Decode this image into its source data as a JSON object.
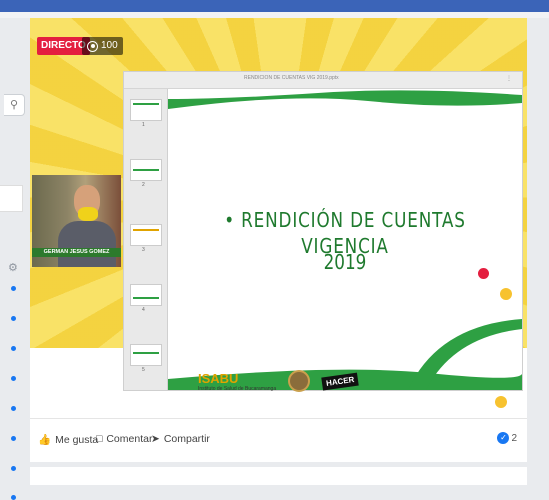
{
  "live": {
    "badge": "DIRECTO",
    "viewers": "100"
  },
  "webcam": {
    "name_label": "GERMAN JESUS GOMEZ"
  },
  "slide_window": {
    "title": "RENDICION DE CUENTAS VIG 2019.pptx",
    "thumbnail_numbers": [
      "1",
      "2",
      "3",
      "4",
      "5"
    ]
  },
  "slide": {
    "title": "• RENDICIÓN DE CUENTAS VIGENCIA",
    "year": "2019"
  },
  "logos": {
    "isabu": "ISABU",
    "isabu_sub": "Instituto de Salud de Bucaramanga",
    "hacer": "HACER"
  },
  "actions": {
    "like": "Me gusta",
    "comment": "Comentar",
    "share": "Compartir",
    "like_count": "2"
  },
  "colors": {
    "accent": "#1877f2",
    "live": "#e41e3f",
    "slide_green": "#1f7a2e",
    "background_yellow": "#f7d94c"
  }
}
